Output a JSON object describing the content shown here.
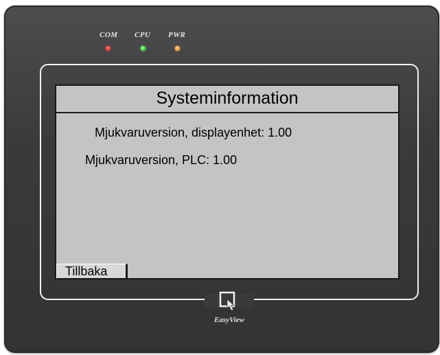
{
  "device": {
    "brand": "EasyView",
    "leds": [
      {
        "label": "COM",
        "color": "#e01818"
      },
      {
        "label": "CPU",
        "color": "#20c020"
      },
      {
        "label": "PWR",
        "color": "#f08a20"
      }
    ]
  },
  "screen": {
    "title": "Systeminformation",
    "lines": [
      "Mjukvaruversion, displayenhet: 1.00",
      "Mjukvaruversion, PLC: 1.00"
    ],
    "back_button": "Tillbaka",
    "background": "#c4c4c4"
  }
}
